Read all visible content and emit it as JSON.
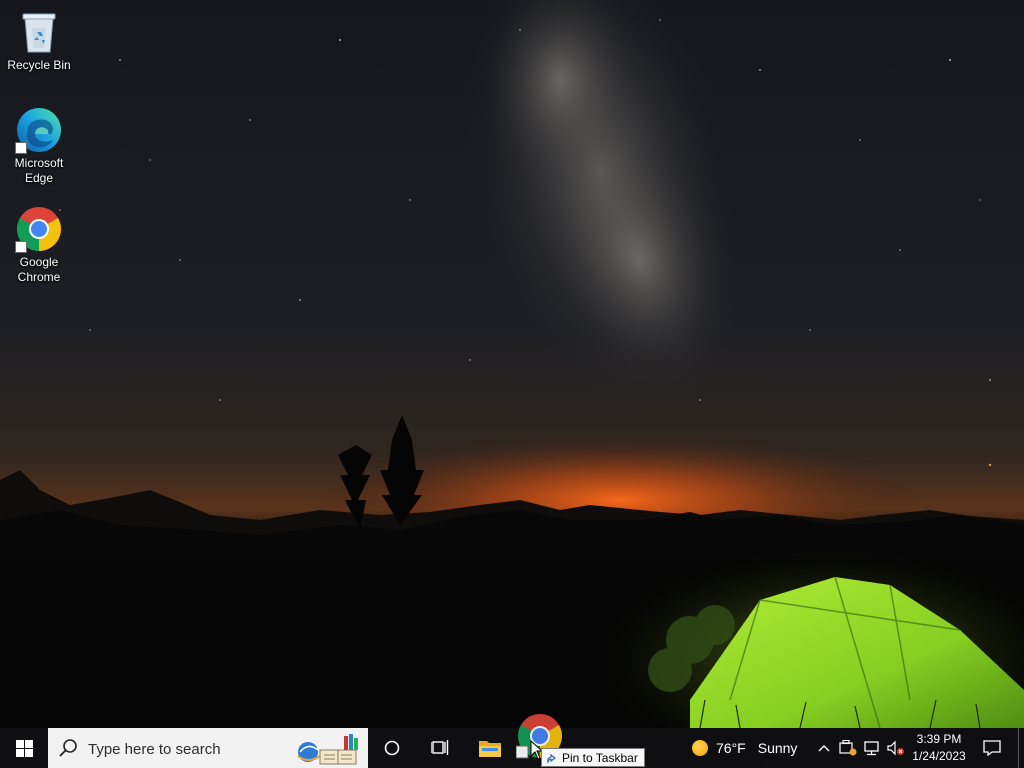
{
  "desktop": {
    "icons": [
      {
        "label": "Recycle Bin",
        "icon": "recycle-bin-icon"
      },
      {
        "label": "Microsoft\nEdge",
        "icon": "edge-icon"
      },
      {
        "label": "Google\nChrome",
        "icon": "chrome-icon"
      }
    ]
  },
  "taskbar": {
    "start_icon": "windows-start-icon",
    "search": {
      "placeholder": "Type here to search"
    },
    "cortana_icon": "cortana-icon",
    "task_view_icon": "task-view-icon",
    "file_explorer_icon": "file-explorer-icon",
    "weather": {
      "temp": "76°F",
      "condition": "Sunny"
    },
    "clock": {
      "time": "3:39 PM",
      "date": "1/24/2023"
    }
  },
  "drag": {
    "tooltip": "Pin to Taskbar"
  },
  "colors": {
    "taskbar": "#101012",
    "search_box": "#f2f2f2",
    "tent": "#8fd62a",
    "horizon_glow": "#e8621c"
  }
}
